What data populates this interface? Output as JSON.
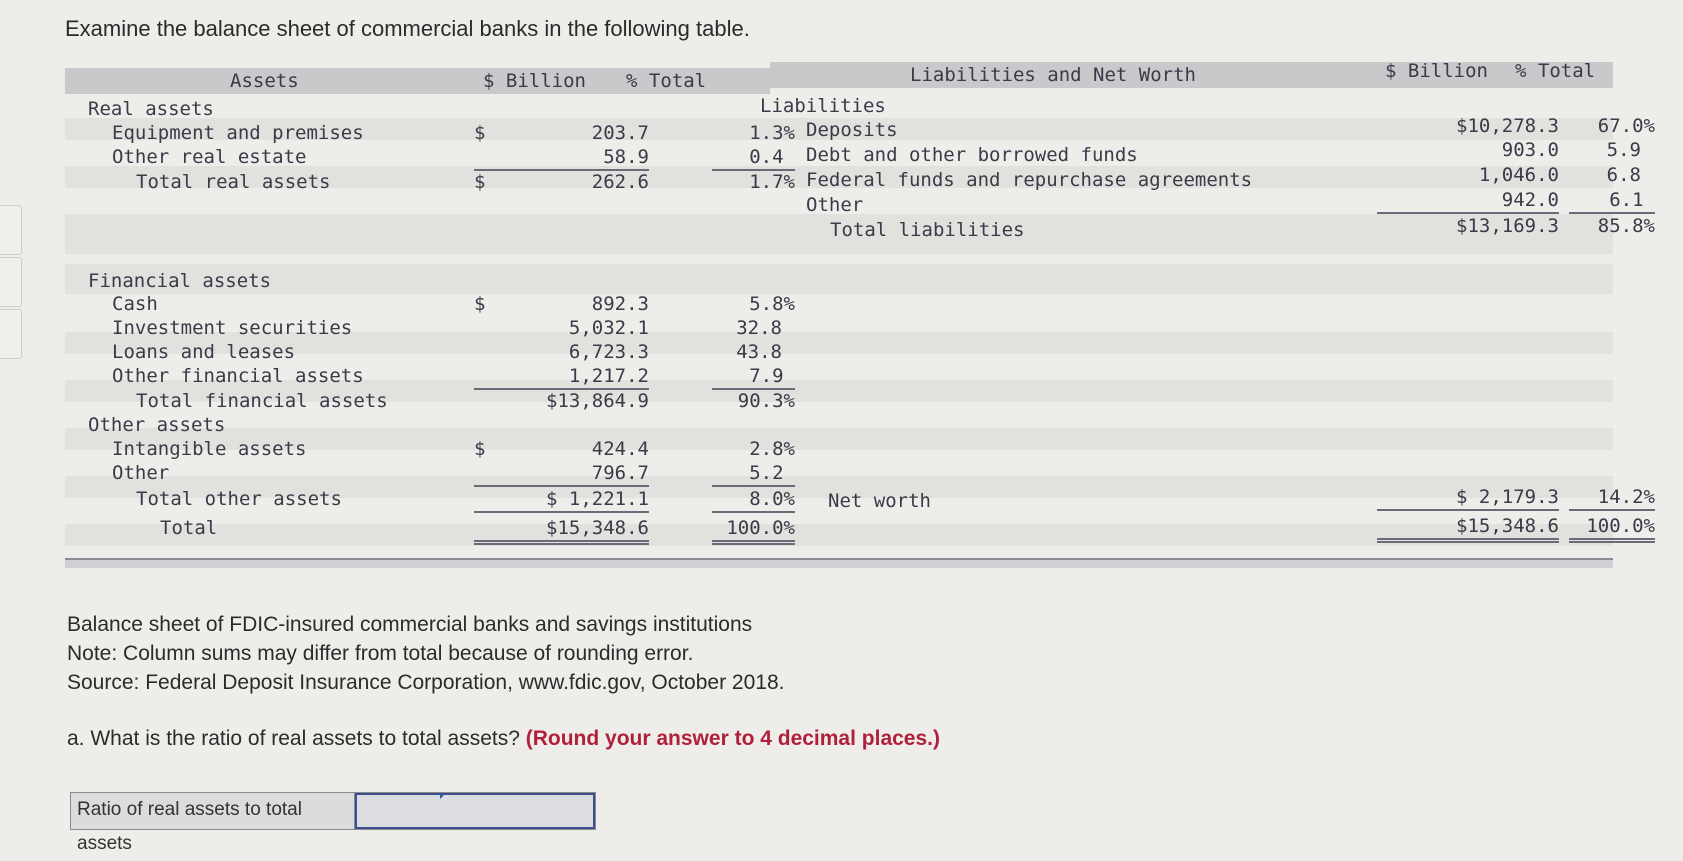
{
  "intro": "Examine the balance sheet of commercial banks in the following table.",
  "table": {
    "headers": {
      "assets": "Assets",
      "billion": "$ Billion",
      "pct_total": "% Total",
      "liab": "Liabilities and Net Worth",
      "billion2": "$ Billion",
      "pct_total2": "% Total"
    },
    "assets": {
      "real_assets": "Real assets",
      "equipment": {
        "label": "Equipment and premises",
        "cur": "$",
        "value": "203.7",
        "pct": "1.3%"
      },
      "other_re": {
        "label": "Other real estate",
        "value": "58.9",
        "pct": "0.4"
      },
      "total_real": {
        "label": "Total real assets",
        "cur": "$",
        "value": "262.6",
        "pct": "1.7%"
      },
      "financial_assets": "Financial assets",
      "cash": {
        "label": "Cash",
        "cur": "$",
        "value": "892.3",
        "pct": "5.8%"
      },
      "investment": {
        "label": "Investment securities",
        "value": "5,032.1",
        "pct": "32.8"
      },
      "loans": {
        "label": "Loans and leases",
        "value": "6,723.3",
        "pct": "43.8"
      },
      "other_fin": {
        "label": "Other financial assets",
        "value": "1,217.2",
        "pct": "7.9"
      },
      "total_fin": {
        "label": "Total financial assets",
        "value": "$13,864.9",
        "pct": "90.3%"
      },
      "other_assets": "Other assets",
      "intangible": {
        "label": "Intangible assets",
        "cur": "$",
        "value": "424.4",
        "pct": "2.8%"
      },
      "other": {
        "label": "Other",
        "value": "796.7",
        "pct": "5.2"
      },
      "total_other": {
        "label": "Total other assets",
        "value": "$ 1,221.1",
        "pct": "8.0%"
      },
      "total": {
        "label": "Total",
        "value": "$15,348.6",
        "pct": "100.0%"
      }
    },
    "liabilities": {
      "heading": "Liabilities",
      "deposits": {
        "label": "Deposits",
        "value": "$10,278.3",
        "pct": "67.0%"
      },
      "debt": {
        "label": "Debt and other borrowed funds",
        "value": "903.0",
        "pct": "5.9"
      },
      "fed_funds": {
        "label": "Federal funds and repurchase agreements",
        "value": "1,046.0",
        "pct": "6.8"
      },
      "other": {
        "label": "Other",
        "value": "942.0",
        "pct": "6.1"
      },
      "total": {
        "label": "Total liabilities",
        "value": "$13,169.3",
        "pct": "85.8%"
      },
      "net_worth": {
        "label": "Net worth",
        "value": "$ 2,179.3",
        "pct": "14.2%"
      },
      "grand_total": {
        "value": "$15,348.6",
        "pct": "100.0%"
      }
    }
  },
  "notes": {
    "caption": "Balance sheet of FDIC-insured commercial banks and savings institutions",
    "note": "Note: Column sums may differ from total because of rounding error.",
    "source": "Source: Federal Deposit Insurance Corporation, www.fdic.gov, October 2018."
  },
  "question": {
    "text": "a. What is the ratio of real assets to total assets? ",
    "instruction": "(Round your answer to 4 decimal places.)"
  },
  "answer": {
    "label": "Ratio of real assets to total assets",
    "value": ""
  }
}
